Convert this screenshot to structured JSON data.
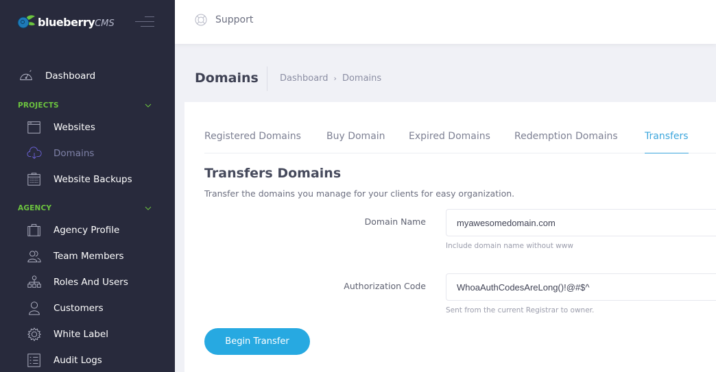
{
  "brand": {
    "name_bold": "blueberry",
    "name_suffix": "CMS"
  },
  "sidebar": {
    "dashboard": {
      "label": "Dashboard",
      "icon": "speedometer-icon"
    },
    "sections": [
      {
        "title": "PROJECTS",
        "items": [
          {
            "label": "Websites",
            "icon": "browser-window-icon",
            "active": false
          },
          {
            "label": "Domains",
            "icon": "cloud-download-icon",
            "active": true
          },
          {
            "label": "Website Backups",
            "icon": "calendar-archive-icon",
            "active": false
          }
        ]
      },
      {
        "title": "AGENCY",
        "items": [
          {
            "label": "Agency Profile",
            "icon": "briefcase-icon",
            "active": false
          },
          {
            "label": "Team Members",
            "icon": "users-icon",
            "active": false
          },
          {
            "label": "Roles And Users",
            "icon": "hierarchy-icon",
            "active": false
          },
          {
            "label": "Customers",
            "icon": "user-icon",
            "active": false
          },
          {
            "label": "White Label",
            "icon": "gear-icon",
            "active": false
          },
          {
            "label": "Audit Logs",
            "icon": "list-icon",
            "active": false
          }
        ]
      }
    ]
  },
  "topbar": {
    "support_label": "Support"
  },
  "subheader": {
    "title": "Domains",
    "breadcrumb": [
      "Dashboard",
      "Domains"
    ],
    "breadcrumb_separator": "›"
  },
  "tabs": [
    {
      "label": "Registered Domains",
      "active": false
    },
    {
      "label": "Buy Domain",
      "active": false
    },
    {
      "label": "Expired Domains",
      "active": false
    },
    {
      "label": "Redemption Domains",
      "active": false
    },
    {
      "label": "Transfers",
      "active": true
    }
  ],
  "form": {
    "title": "Transfers Domains",
    "description": "Transfer the domains you manage for your clients for easy organization.",
    "fields": [
      {
        "label": "Domain Name",
        "value": "myawesomedomain.com",
        "help": "Include domain name without www"
      },
      {
        "label": "Authorization Code",
        "value": "WhoaAuthCodesAreLong()!@#$^",
        "help": "Sent from the current Registrar to owner."
      }
    ],
    "submit_label": "Begin Transfer"
  },
  "colors": {
    "sidebar_bg": "#282a3c",
    "section_title": "#6cc43f",
    "accent": "#27a9e1",
    "active_nav": "#7f82a8"
  }
}
